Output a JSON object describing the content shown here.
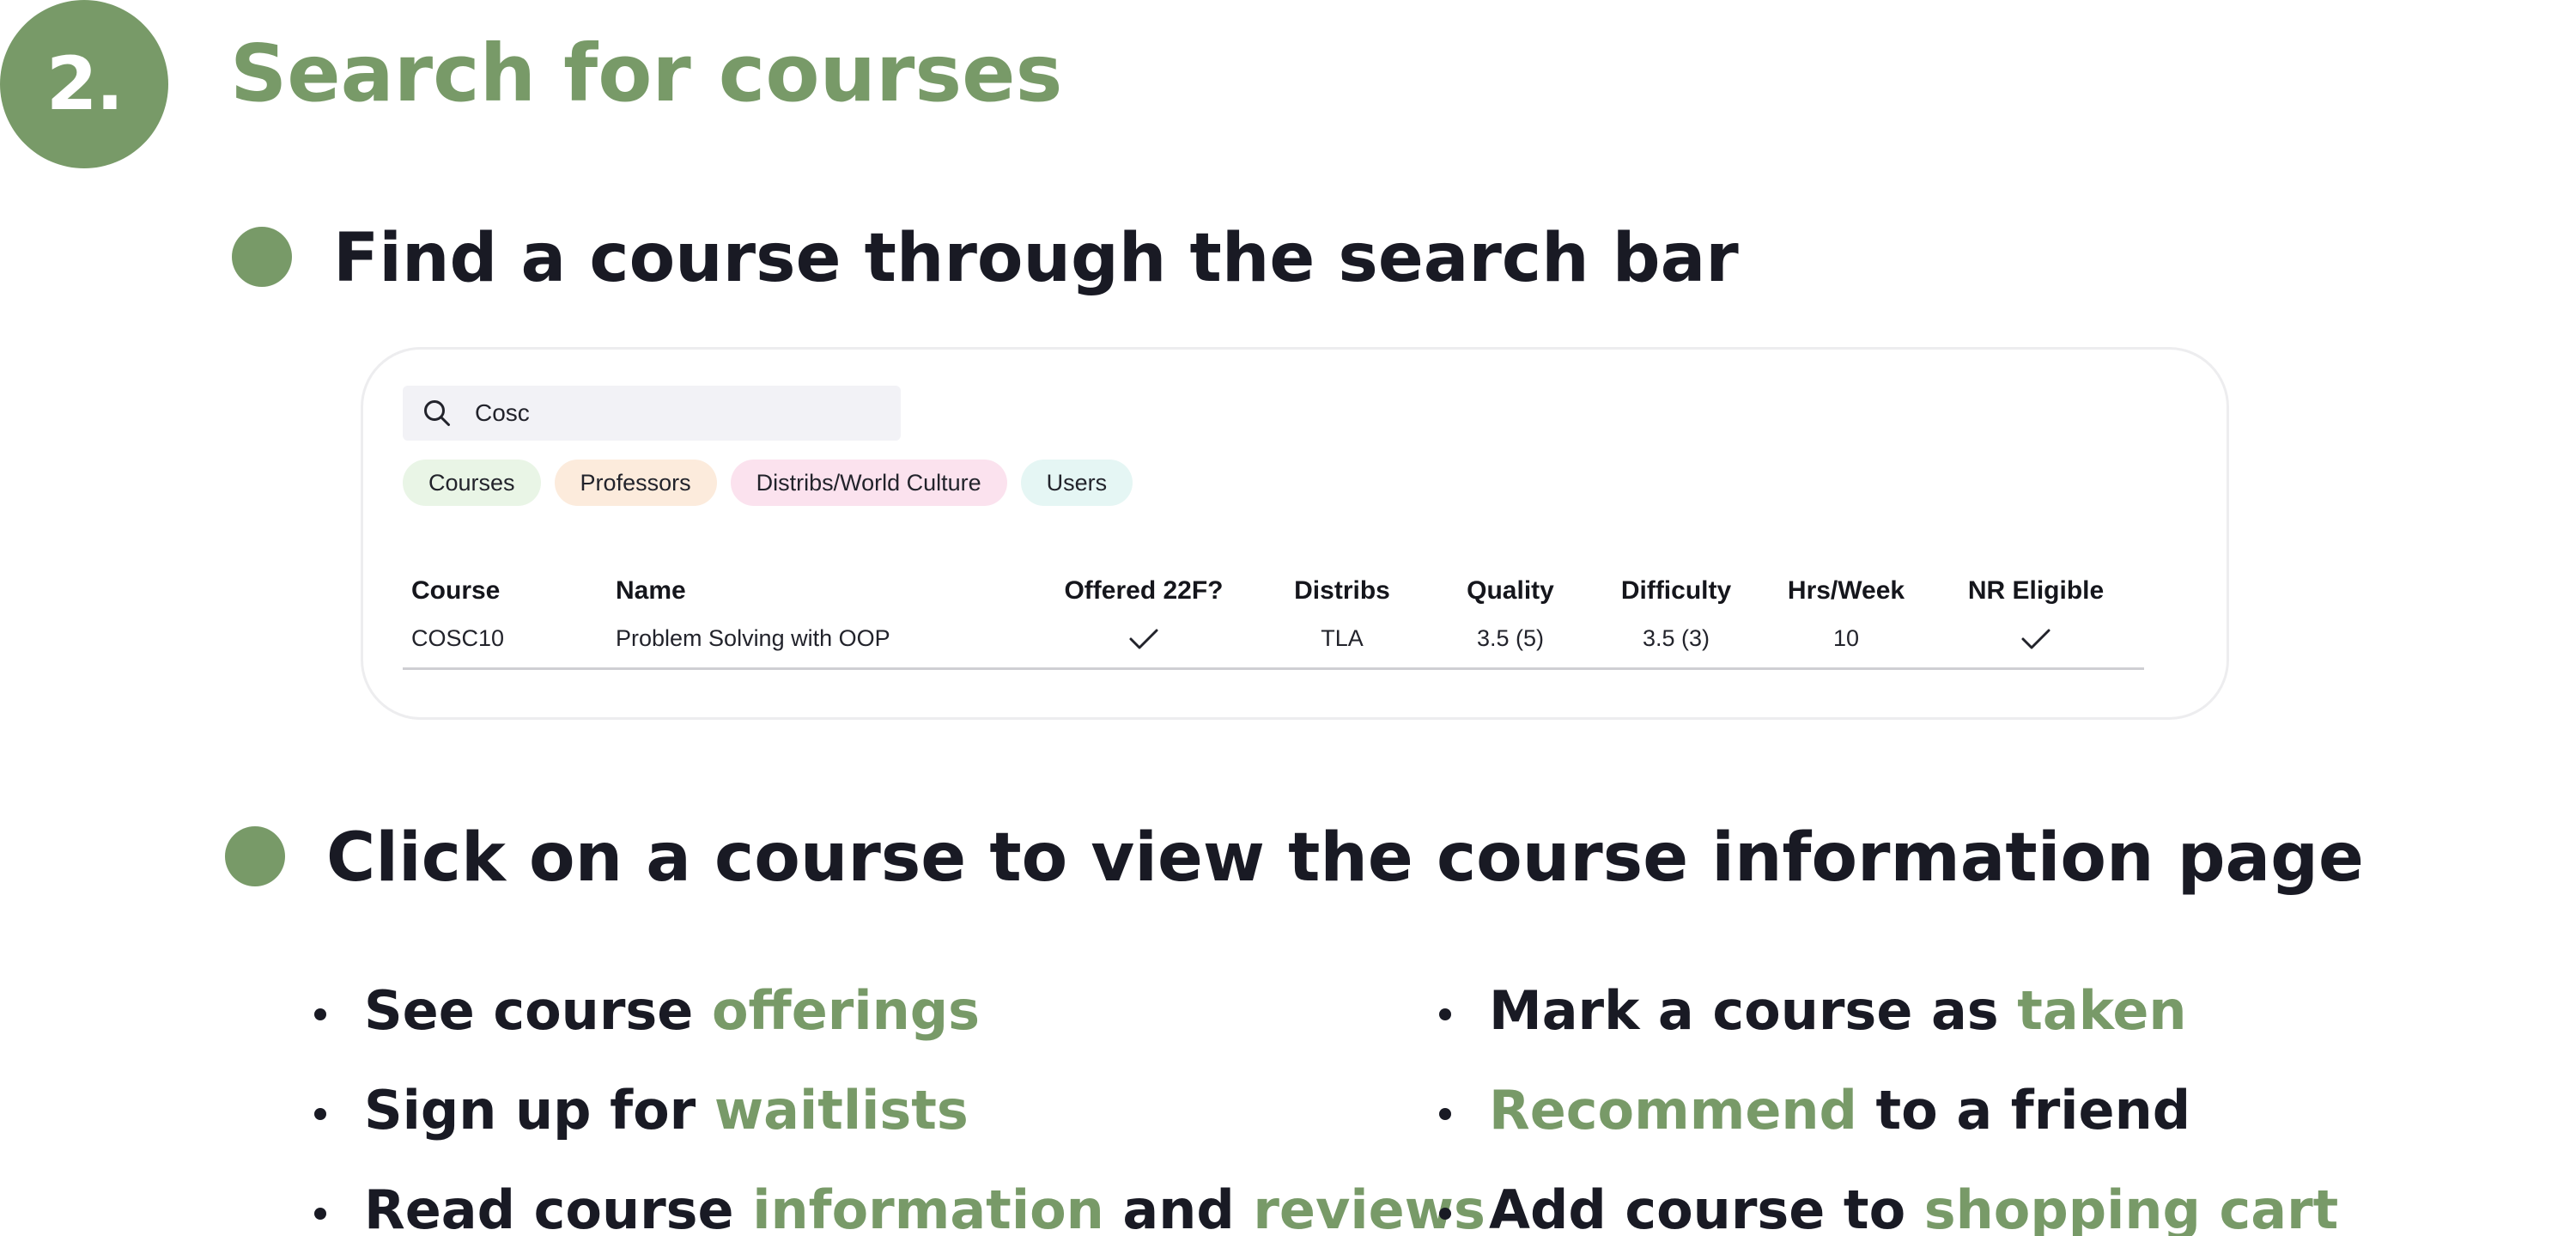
{
  "step": {
    "number": "2.",
    "title": "Search for courses"
  },
  "sections": [
    {
      "heading": "Find a course through the search bar"
    },
    {
      "heading": "Click on a course to view the course information page"
    }
  ],
  "search": {
    "query": "Cosc",
    "icon": "search-icon"
  },
  "filters": [
    {
      "label": "Courses",
      "color": "#e9f5e6"
    },
    {
      "label": "Professors",
      "color": "#fcebdc"
    },
    {
      "label": "Distribs/World Culture",
      "color": "#fbe2ee"
    },
    {
      "label": "Users",
      "color": "#e5f6f4"
    }
  ],
  "table": {
    "headers": [
      "Course",
      "Name",
      "Offered 22F?",
      "Distribs",
      "Quality",
      "Difficulty",
      "Hrs/Week",
      "NR Eligible"
    ],
    "rows": [
      {
        "course": "COSC10",
        "name": "Problem Solving with OOP",
        "offered": "check-icon",
        "distribs": "TLA",
        "quality": "3.5 (5)",
        "difficulty": "3.5 (3)",
        "hrs_week": "10",
        "nr_eligible": "check-icon"
      }
    ]
  },
  "features": {
    "left": [
      {
        "text": "See course ",
        "accent": "offerings"
      },
      {
        "text": "Sign up for ",
        "accent": "waitlists"
      },
      {
        "text": "Read course ",
        "accent": "information",
        "text2": " and ",
        "accent2": "reviews"
      }
    ],
    "right": [
      {
        "text": "Mark a course as ",
        "accent": "taken"
      },
      {
        "accent": "Recommend",
        "text": " to a friend"
      },
      {
        "text": "Add course to ",
        "accent": "shopping cart"
      }
    ]
  },
  "colors": {
    "accent": "#789a68",
    "heading": "#191a24"
  }
}
